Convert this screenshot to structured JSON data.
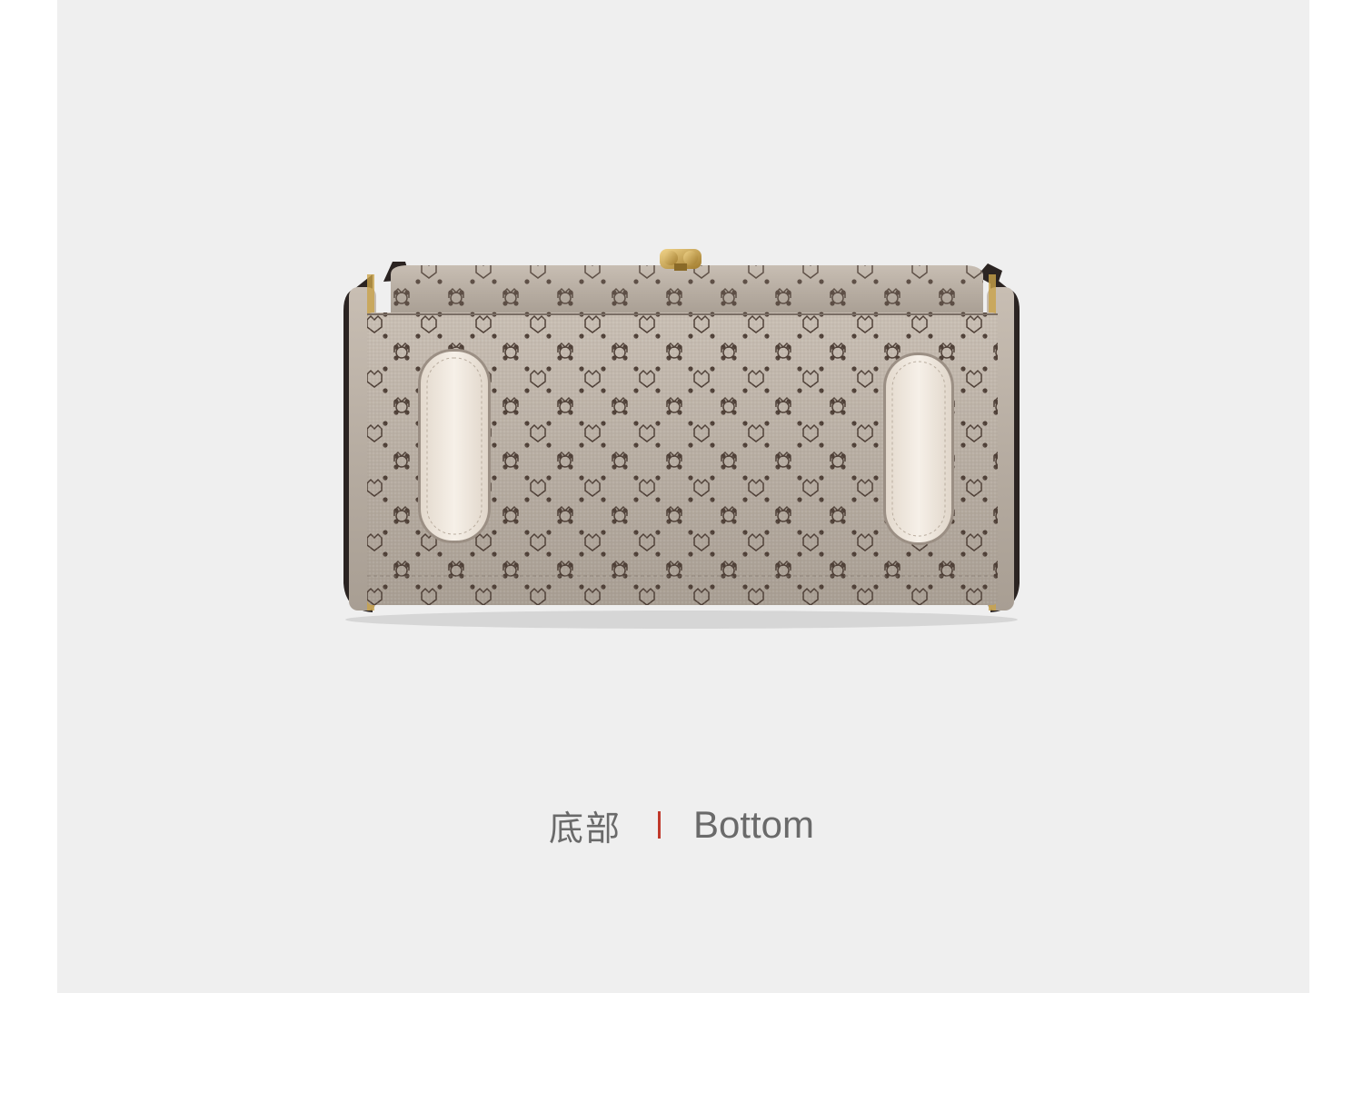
{
  "colors": {
    "panel_background": "#efefef",
    "page_background": "#ffffff",
    "canvas_fabric": "#b8aea3",
    "monogram_print": "#4e3f36",
    "leather_feet": "#f3ece4",
    "clasp": "#c9a24a",
    "separator": "#c0392b",
    "caption_text": "#6a6a6a"
  },
  "caption": {
    "chinese": "底部",
    "english": "Bottom"
  }
}
